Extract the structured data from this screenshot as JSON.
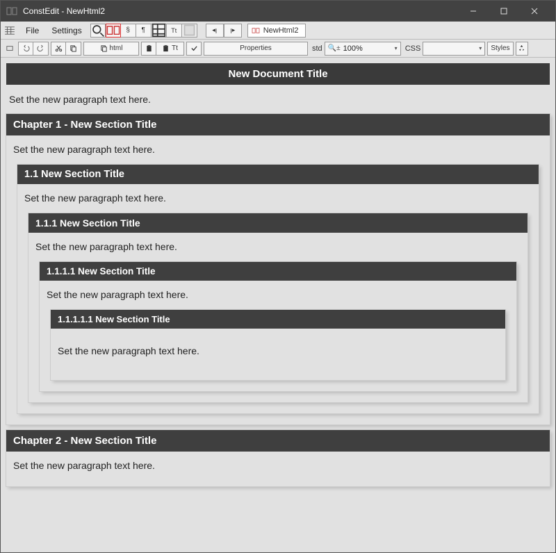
{
  "window": {
    "title": "ConstEdit - NewHtml2"
  },
  "menu": {
    "file": "File",
    "settings": "Settings"
  },
  "toolbar1": {
    "tab_label": "NewHtml2"
  },
  "toolbar2": {
    "html_label": "html",
    "tt_label": "Tt",
    "properties": "Properties",
    "std": "std",
    "zoom_prefix": "⯑ ±",
    "zoom": "100%",
    "css_label": "CSS",
    "css_value": "",
    "styles": "Styles"
  },
  "document": {
    "title": "New Document Title",
    "para0": "Set the new paragraph text here.",
    "sections": [
      {
        "heading": "Chapter 1 - New Section Title",
        "para": "Set the new paragraph text here.",
        "children": [
          {
            "heading": "1.1 New Section Title",
            "para": "Set the new paragraph text here.",
            "children": [
              {
                "heading": "1.1.1 New Section Title",
                "para": "Set the new paragraph text here.",
                "children": [
                  {
                    "heading": "1.1.1.1 New Section Title",
                    "para": "Set the new paragraph text here.",
                    "children": [
                      {
                        "heading": "1.1.1.1.1 New Section Title",
                        "para": "Set the new paragraph text here."
                      }
                    ]
                  }
                ]
              }
            ]
          }
        ]
      },
      {
        "heading": "Chapter 2 - New Section Title",
        "para": "Set the new paragraph text here."
      }
    ]
  }
}
